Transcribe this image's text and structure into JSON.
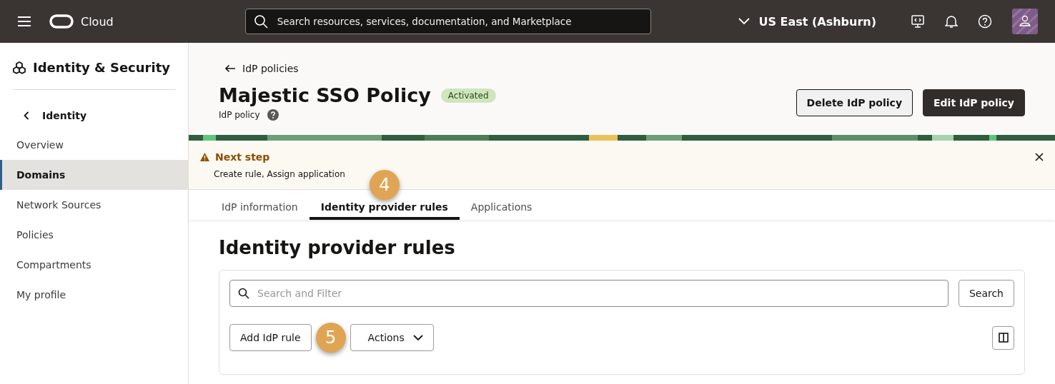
{
  "topbar": {
    "brand": "Cloud",
    "search_placeholder": "Search resources, services, documentation, and Marketplace",
    "region": "US East (Ashburn)"
  },
  "sidebar": {
    "title": "Identity & Security",
    "back": "Identity",
    "items": [
      {
        "label": "Overview",
        "selected": false
      },
      {
        "label": "Domains",
        "selected": true
      },
      {
        "label": "Network Sources",
        "selected": false
      },
      {
        "label": "Policies",
        "selected": false
      },
      {
        "label": "Compartments",
        "selected": false
      },
      {
        "label": "My profile",
        "selected": false
      }
    ]
  },
  "header": {
    "breadcrumb": "IdP policies",
    "title": "Majestic SSO Policy",
    "status": "Activated",
    "subtitle": "IdP policy",
    "buttons": [
      {
        "label": "Delete IdP policy",
        "kind": "secondary"
      },
      {
        "label": "Edit IdP policy",
        "kind": "primary"
      }
    ]
  },
  "notice": {
    "title": "Next step",
    "text": "Create rule, Assign application"
  },
  "tabs": [
    {
      "label": "IdP information",
      "selected": false
    },
    {
      "label": "Identity provider rules",
      "selected": true
    },
    {
      "label": "Applications",
      "selected": false
    }
  ],
  "section": {
    "title": "Identity provider rules",
    "filter_placeholder": "Search and Filter",
    "search_button": "Search",
    "add_button": "Add IdP rule",
    "actions_button": "Actions"
  },
  "callouts": [
    "4",
    "5"
  ]
}
